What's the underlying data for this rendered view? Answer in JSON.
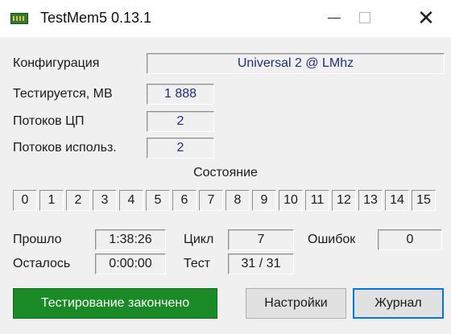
{
  "window": {
    "title": "TestMem5  0.13.1",
    "minimize": "",
    "maximize": "",
    "close": "✕"
  },
  "config": {
    "label": "Конфигурация",
    "value": "Universal 2 @ LMhz"
  },
  "tested": {
    "label": "Тестируется, MB",
    "value": "1 888"
  },
  "cpu_threads": {
    "label": "Потоков ЦП",
    "value": "2"
  },
  "threads_used": {
    "label": "Потоков использ.",
    "value": "2"
  },
  "state": {
    "title": "Состояние",
    "threads": [
      "0",
      "1",
      "2",
      "3",
      "4",
      "5",
      "6",
      "7",
      "8",
      "9",
      "10",
      "11",
      "12",
      "13",
      "14",
      "15"
    ]
  },
  "stats": {
    "elapsed_label": "Прошло",
    "elapsed_value": "1:38:26",
    "remaining_label": "Осталось",
    "remaining_value": "0:00:00",
    "cycle_label": "Цикл",
    "cycle_value": "7",
    "test_label": "Тест",
    "test_value": "31 / 31",
    "errors_label": "Ошибок",
    "errors_value": "0"
  },
  "footer": {
    "status": "Тестирование закончено",
    "settings_button": "Настройки",
    "log_button": "Журнал"
  },
  "colors": {
    "status_green": "#198a25",
    "field_text_blue": "#1f2f7a",
    "focus_blue": "#0078d7"
  }
}
